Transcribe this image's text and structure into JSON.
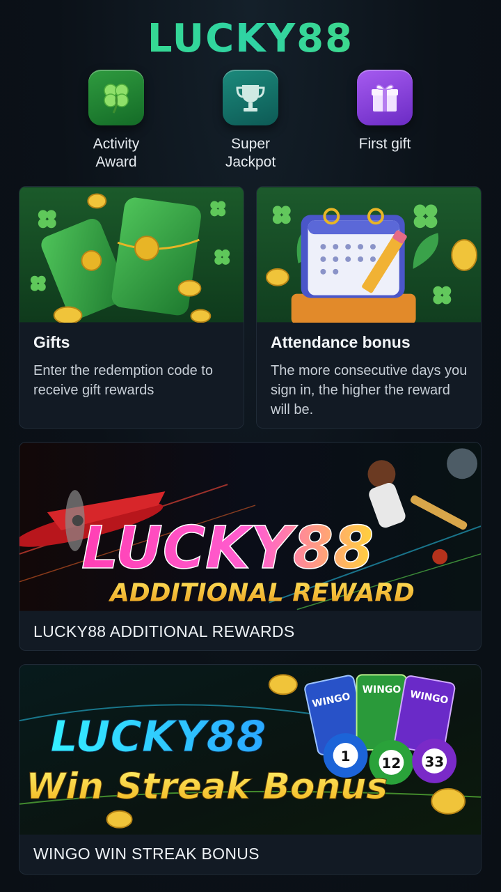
{
  "header": {
    "brand": "LUCKY88"
  },
  "quick_actions": [
    {
      "label": "Activity\nAward",
      "icon": "clover-icon"
    },
    {
      "label": "Super\nJackpot",
      "icon": "trophy-icon"
    },
    {
      "label": "First gift",
      "icon": "gift-icon"
    }
  ],
  "cards": [
    {
      "title": "Gifts",
      "description": "Enter the redemption code to receive gift rewards"
    },
    {
      "title": "Attendance bonus",
      "description": "The more consecutive days you sign in, the higher the reward will be."
    }
  ],
  "banners": [
    {
      "headline": "LUCKY88",
      "subheadline": "ADDITIONAL REWARD",
      "caption": "LUCKY88 ADDITIONAL REWARDS"
    },
    {
      "headline": "LUCKY88",
      "subheadline": "Win Streak Bonus",
      "caption": "WINGO WIN STREAK BONUS",
      "cards": [
        "WINGO",
        "WINGO",
        "WINGO"
      ],
      "balls": [
        "1",
        "12",
        "33"
      ]
    }
  ],
  "colors": {
    "accent": "#3fe07a",
    "card_bg": "#121a24",
    "page_bg": "#0b1118"
  }
}
